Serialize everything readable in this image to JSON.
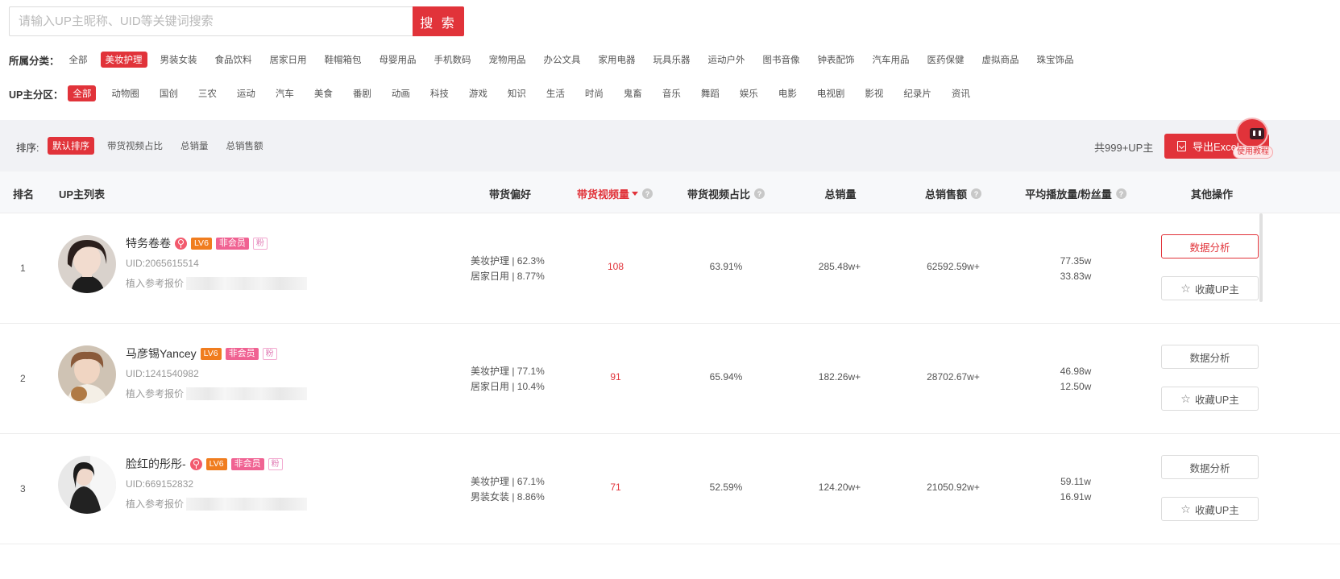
{
  "search": {
    "placeholder": "请输入UP主昵称、UID等关键词搜索",
    "button_label": "搜 索"
  },
  "filters": {
    "category_label": "所属分类：",
    "categories": [
      {
        "label": "全部",
        "active": false
      },
      {
        "label": "美妆护理",
        "active": true
      },
      {
        "label": "男装女装",
        "active": false
      },
      {
        "label": "食品饮料",
        "active": false
      },
      {
        "label": "居家日用",
        "active": false
      },
      {
        "label": "鞋帽箱包",
        "active": false
      },
      {
        "label": "母婴用品",
        "active": false
      },
      {
        "label": "手机数码",
        "active": false
      },
      {
        "label": "宠物用品",
        "active": false
      },
      {
        "label": "办公文具",
        "active": false
      },
      {
        "label": "家用电器",
        "active": false
      },
      {
        "label": "玩具乐器",
        "active": false
      },
      {
        "label": "运动户外",
        "active": false
      },
      {
        "label": "图书音像",
        "active": false
      },
      {
        "label": "钟表配饰",
        "active": false
      },
      {
        "label": "汽车用品",
        "active": false
      },
      {
        "label": "医药保健",
        "active": false
      },
      {
        "label": "虚拟商品",
        "active": false
      },
      {
        "label": "珠宝饰品",
        "active": false
      }
    ],
    "zone_label": "UP主分区：",
    "zones": [
      {
        "label": "全部",
        "active": true
      },
      {
        "label": "动物圈",
        "active": false
      },
      {
        "label": "国创",
        "active": false
      },
      {
        "label": "三农",
        "active": false
      },
      {
        "label": "运动",
        "active": false
      },
      {
        "label": "汽车",
        "active": false
      },
      {
        "label": "美食",
        "active": false
      },
      {
        "label": "番剧",
        "active": false
      },
      {
        "label": "动画",
        "active": false
      },
      {
        "label": "科技",
        "active": false
      },
      {
        "label": "游戏",
        "active": false
      },
      {
        "label": "知识",
        "active": false
      },
      {
        "label": "生活",
        "active": false
      },
      {
        "label": "时尚",
        "active": false
      },
      {
        "label": "鬼畜",
        "active": false
      },
      {
        "label": "音乐",
        "active": false
      },
      {
        "label": "舞蹈",
        "active": false
      },
      {
        "label": "娱乐",
        "active": false
      },
      {
        "label": "电影",
        "active": false
      },
      {
        "label": "电视剧",
        "active": false
      },
      {
        "label": "影视",
        "active": false
      },
      {
        "label": "纪录片",
        "active": false
      },
      {
        "label": "资讯",
        "active": false
      }
    ]
  },
  "sort": {
    "label": "排序:",
    "options": [
      {
        "label": "默认排序",
        "active": true
      },
      {
        "label": "带货视频占比",
        "active": false
      },
      {
        "label": "总销量",
        "active": false
      },
      {
        "label": "总销售额",
        "active": false
      }
    ],
    "total": "共999+UP主",
    "export_label": "导出Excel",
    "tutorial_label": "使用教程"
  },
  "table": {
    "headers": {
      "rank": "排名",
      "up_list": "UP主列表",
      "preference": "带货偏好",
      "video_count": "带货视频量",
      "video_ratio": "带货视频占比",
      "total_sales": "总销量",
      "total_revenue": "总销售额",
      "avg_play_fans": "平均播放量/粉丝量",
      "actions": "其他操作"
    },
    "help_glyph": "?",
    "rows": [
      {
        "rank": "1",
        "name": "特务卷卷",
        "level": "LV6",
        "member": "非会员",
        "fan": "粉",
        "uid": "UID:2065615514",
        "price_label": "植入参考报价",
        "pref_1": "美妆护理 | 62.3%",
        "pref_2": "居家日用 | 8.77%",
        "video_count": "108",
        "video_ratio": "63.91%",
        "total_sales": "285.48w+",
        "total_revenue": "62592.59w+",
        "avg_play": "77.35w",
        "fans": "33.83w"
      },
      {
        "rank": "2",
        "name": "马彦锡Yancey",
        "level": "LV6",
        "member": "非会员",
        "fan": "粉",
        "uid": "UID:1241540982",
        "price_label": "植入参考报价",
        "pref_1": "美妆护理 | 77.1%",
        "pref_2": "居家日用 | 10.4%",
        "video_count": "91",
        "video_ratio": "65.94%",
        "total_sales": "182.26w+",
        "total_revenue": "28702.67w+",
        "avg_play": "46.98w",
        "fans": "12.50w"
      },
      {
        "rank": "3",
        "name": "脸红的彤彤-",
        "level": "LV6",
        "member": "非会员",
        "fan": "粉",
        "uid": "UID:669152832",
        "price_label": "植入参考报价",
        "pref_1": "美妆护理 | 67.1%",
        "pref_2": "男装女装 | 8.86%",
        "video_count": "71",
        "video_ratio": "52.59%",
        "total_sales": "124.20w+",
        "total_revenue": "21050.92w+",
        "avg_play": "59.11w",
        "fans": "16.91w"
      }
    ],
    "actions": {
      "analysis": "数据分析",
      "favorite": "收藏UP主"
    }
  },
  "colors": {
    "accent": "#e1333a",
    "sort_bar_bg": "#f1f2f5",
    "level_badge": "#f07d1f",
    "member_badge": "#f06292"
  }
}
